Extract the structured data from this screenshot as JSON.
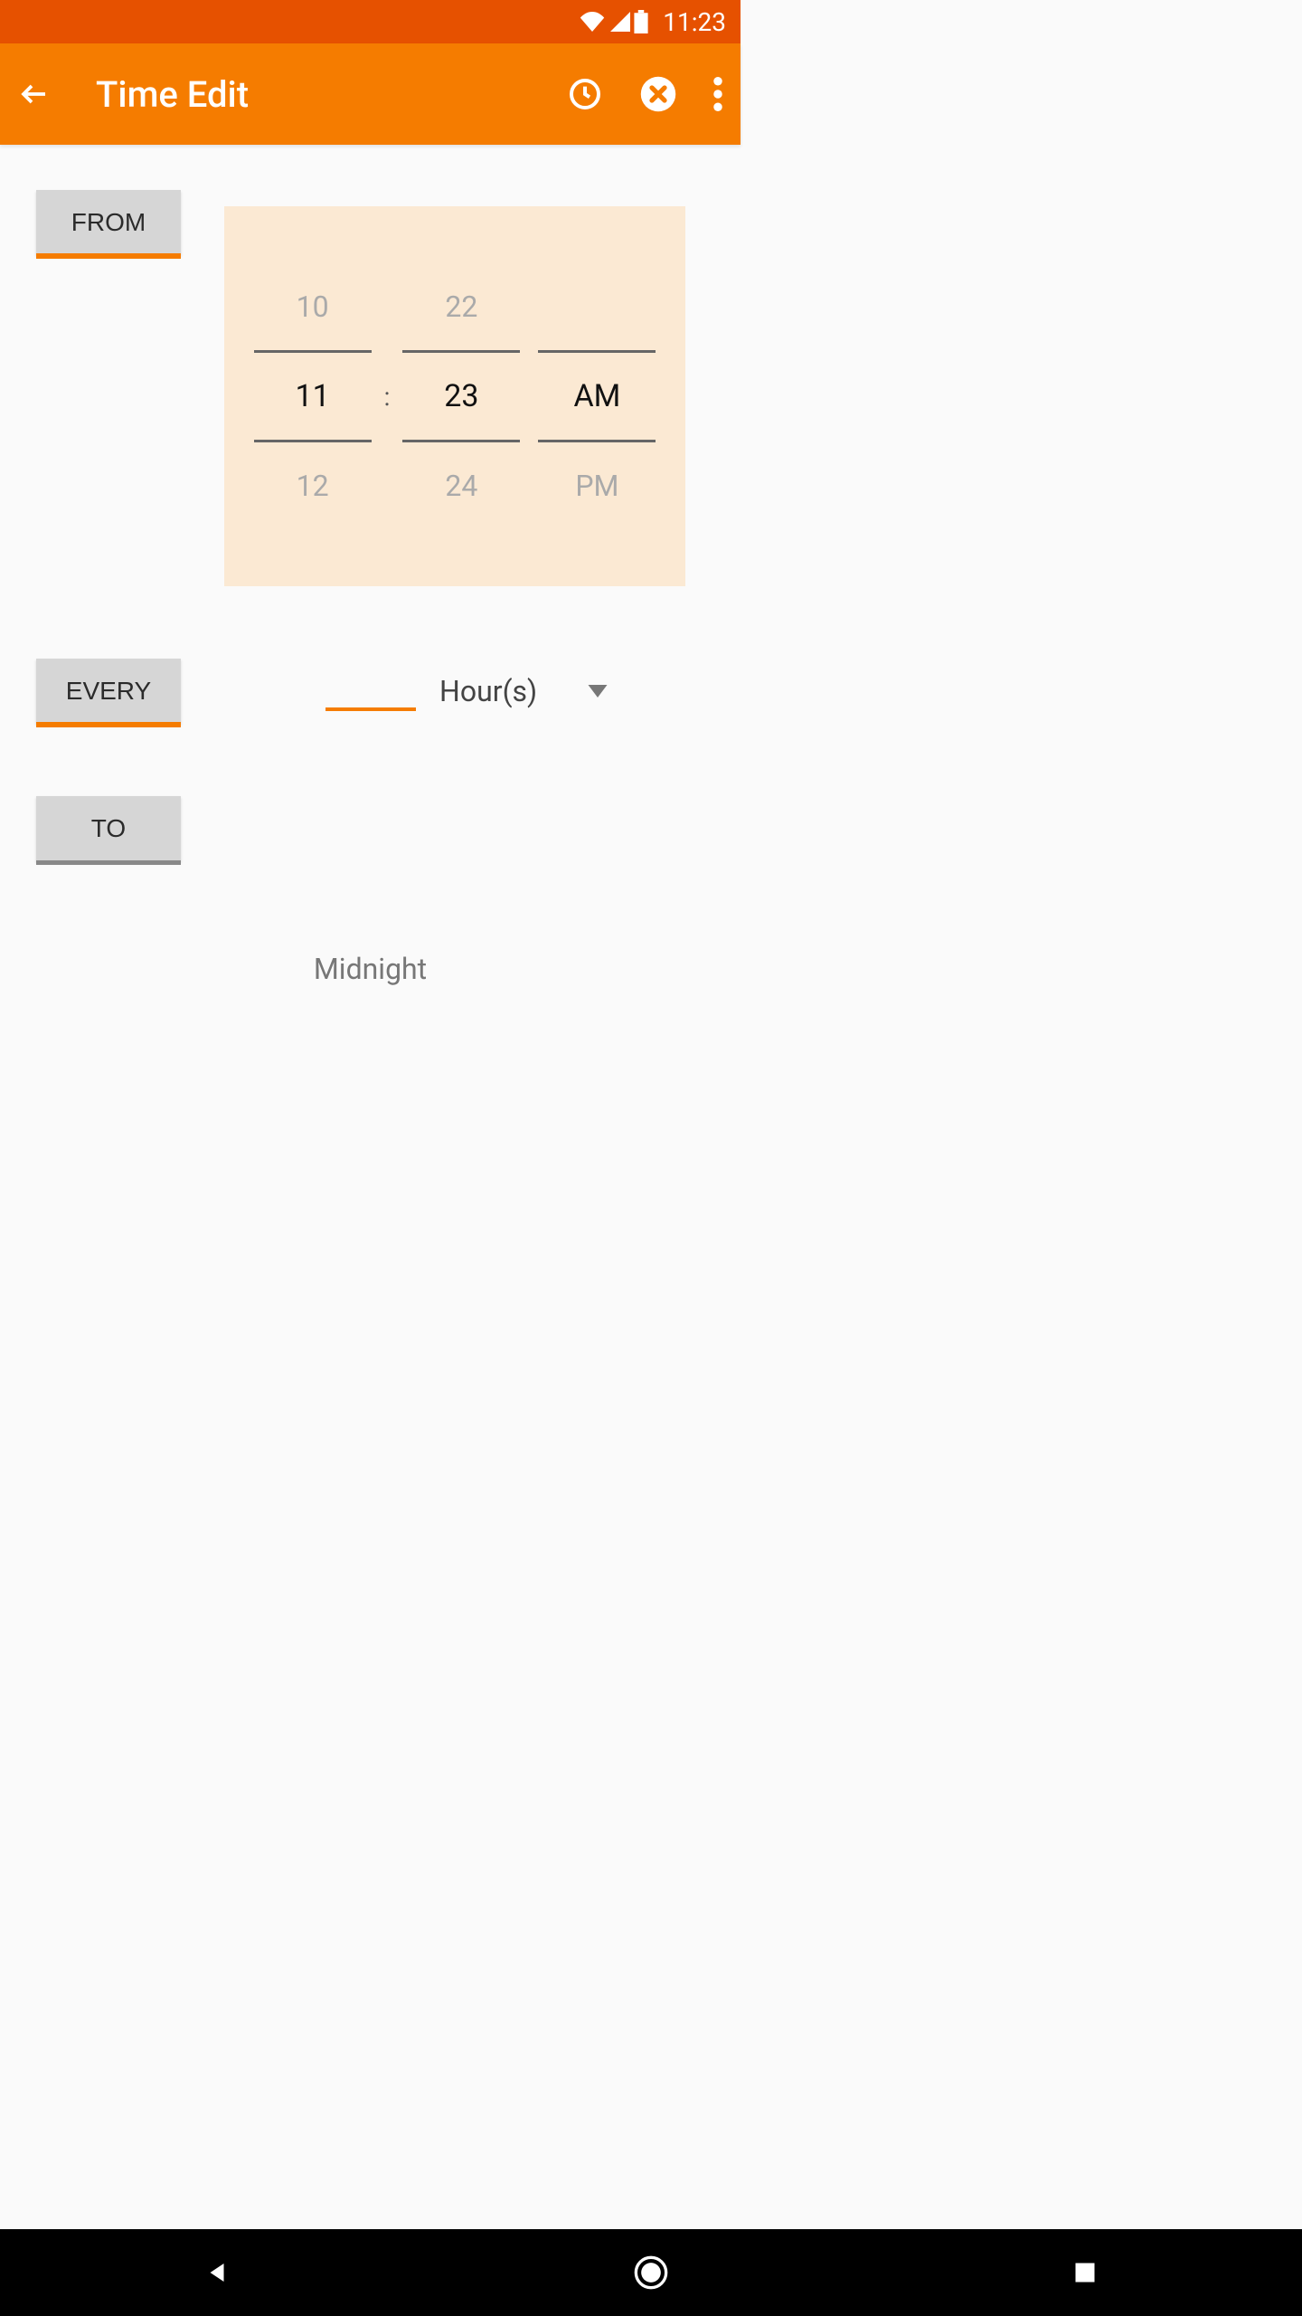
{
  "status": {
    "time": "11:23"
  },
  "appbar": {
    "title": "Time Edit"
  },
  "labels": {
    "from": "FROM",
    "every": "EVERY",
    "to": "TO"
  },
  "timepicker": {
    "hour": {
      "prev": "10",
      "cur": "11",
      "next": "12"
    },
    "minute": {
      "prev": "22",
      "cur": "23",
      "next": "24"
    },
    "ampm": {
      "prev": "",
      "cur": "AM",
      "next": "PM"
    }
  },
  "every": {
    "value": "",
    "unit": "Hour(s)"
  },
  "to": {
    "text": "Midnight"
  }
}
